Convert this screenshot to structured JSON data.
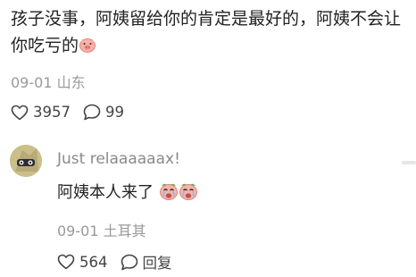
{
  "comment": {
    "text": "孩子没事，阿姨留给你的肯定是最好的，阿姨不会让你吃亏的",
    "date": "09-01",
    "location": "山东",
    "like_count": "3957",
    "reply_count": "99"
  },
  "reply": {
    "username": "Just relaaaaaax!",
    "text": "阿姨本人来了",
    "date": "09-01",
    "location": "土耳其",
    "like_count": "564",
    "reply_label": "回复"
  },
  "colors": {
    "text": "#222222",
    "meta": "#9a9a9a",
    "emoji": "#f4a6a0"
  },
  "icons": [
    "pig-face-emoji",
    "crying-face-emoji",
    "heart-outline-icon",
    "comment-bubble-icon"
  ]
}
